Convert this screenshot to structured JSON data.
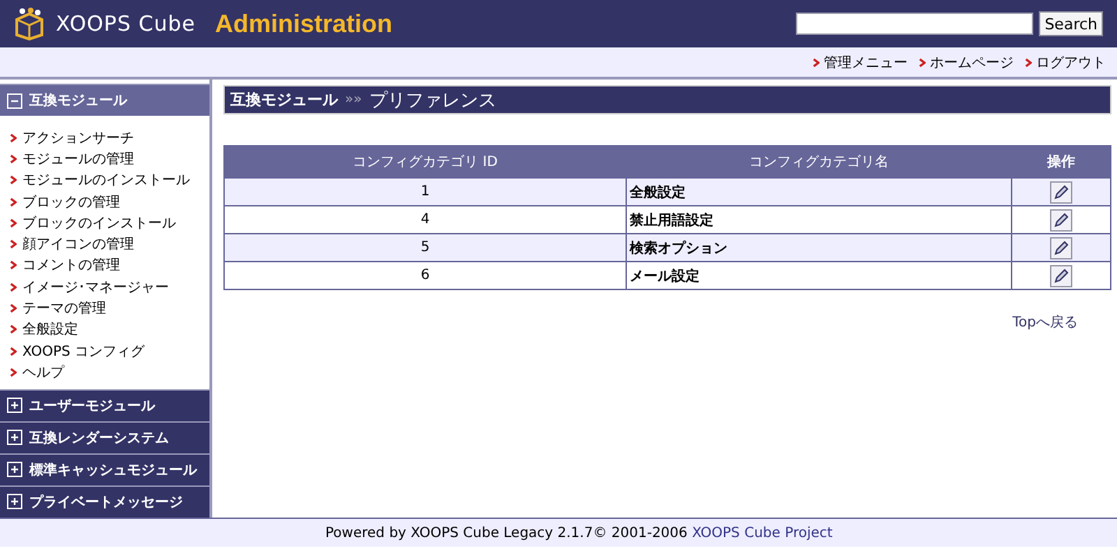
{
  "header": {
    "logo_text": "XOOPS Cube",
    "title": "Administration",
    "search": {
      "button": "Search"
    }
  },
  "nav_links": [
    "管理メニュー",
    "ホームページ",
    "ログアウト"
  ],
  "sidebar": [
    {
      "title": "互換モジュール",
      "expanded": true,
      "items": [
        "アクションサーチ",
        "モジュールの管理",
        "モジュールのインストール",
        "ブロックの管理",
        "ブロックのインストール",
        "顔アイコンの管理",
        "コメントの管理",
        "イメージ･マネージャー",
        "テーマの管理",
        "全般設定",
        "XOOPS コンフィグ",
        "ヘルプ"
      ]
    },
    {
      "title": "ユーザーモジュール",
      "expanded": false
    },
    {
      "title": "互換レンダーシステム",
      "expanded": false
    },
    {
      "title": "標準キャッシュモジュール",
      "expanded": false
    },
    {
      "title": "プライベートメッセージ",
      "expanded": false
    }
  ],
  "breadcrumb": {
    "parent": "互換モジュール",
    "separator": "»»",
    "current": "プリファレンス"
  },
  "table": {
    "columns": [
      "コンフィグカテゴリ ID",
      "コンフィグカテゴリ名",
      "操作"
    ],
    "rows": [
      {
        "id": "1",
        "name": "全般設定"
      },
      {
        "id": "4",
        "name": "禁止用語設定"
      },
      {
        "id": "5",
        "name": "検索オプション"
      },
      {
        "id": "6",
        "name": "メール設定"
      }
    ]
  },
  "top_link": "Topへ戻る",
  "footer": {
    "text": "Powered by XOOPS Cube Legacy 2.1.7© 2001-2006 ",
    "link": "XOOPS Cube Project"
  }
}
